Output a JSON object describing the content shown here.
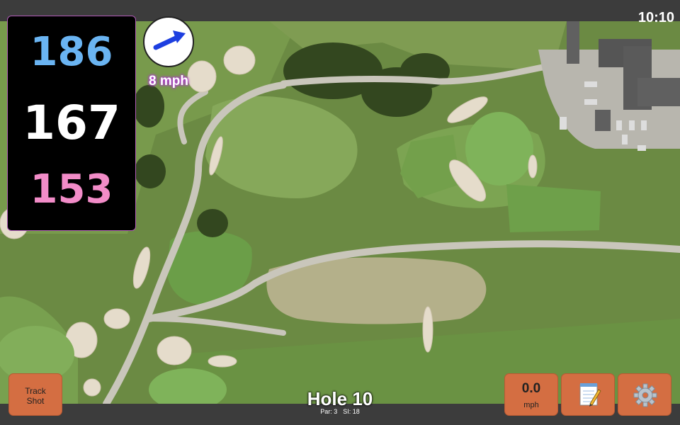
{
  "status_bar": {
    "time": "10:10"
  },
  "distances": {
    "back": "186",
    "middle": "167",
    "front": "153"
  },
  "wind": {
    "speed_label": "8 mph",
    "direction_icon": "arrow-icon"
  },
  "hole": {
    "title": "Hole 10",
    "par": "Par: 3",
    "stroke_index": "SI: 18"
  },
  "buttons": {
    "track_shot_line1": "Track",
    "track_shot_line2": "Shot",
    "speed_value": "0.0",
    "speed_unit": "mph",
    "notes_icon": "notepad-icon",
    "settings_icon": "gear-icon"
  },
  "colors": {
    "back_distance": "#6ab4f2",
    "middle_distance": "#ffffff",
    "front_distance": "#f28cc8",
    "button_bg": "#d46e42",
    "wind_glow": "#b13cd0"
  }
}
